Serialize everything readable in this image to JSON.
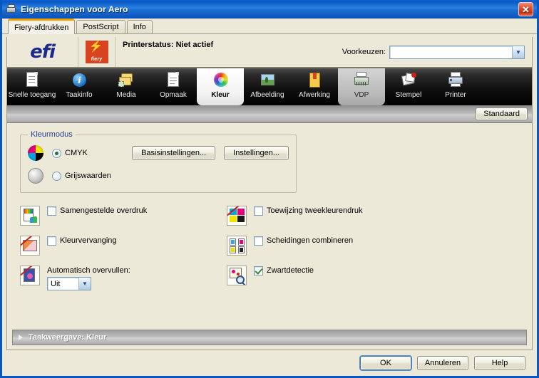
{
  "window": {
    "title": "Eigenschappen voor Aero",
    "title_icon": "printer-properties-icon",
    "close_label": "✕"
  },
  "tabs": [
    {
      "label": "Fiery-afdrukken",
      "active": true
    },
    {
      "label": "PostScript",
      "active": false
    },
    {
      "label": "Info",
      "active": false
    }
  ],
  "header": {
    "efi_logo": "efi",
    "fiery_logo": "fiery",
    "status": "Printerstatus: Niet actief",
    "preset_label": "Voorkeuzen:",
    "preset_value": "",
    "preset_placeholder": ""
  },
  "iconbar": {
    "items": [
      {
        "label": "Snelle toegang",
        "icon": "document-quick-access-icon",
        "state": "normal"
      },
      {
        "label": "Taakinfo",
        "icon": "info-circle-icon",
        "state": "normal"
      },
      {
        "label": "Media",
        "icon": "media-stack-icon",
        "state": "normal"
      },
      {
        "label": "Opmaak",
        "icon": "layout-page-icon",
        "state": "normal"
      },
      {
        "label": "Kleur",
        "icon": "color-wheel-icon",
        "state": "selected"
      },
      {
        "label": "Afbeelding",
        "icon": "picture-icon",
        "state": "normal"
      },
      {
        "label": "Afwerking",
        "icon": "book-finishing-icon",
        "state": "normal"
      },
      {
        "label": "VDP",
        "icon": "vdp-printer-icon",
        "state": "hover"
      },
      {
        "label": "Stempel",
        "icon": "stamp-icon",
        "state": "normal"
      },
      {
        "label": "Printer",
        "icon": "printer-icon",
        "state": "normal"
      }
    ]
  },
  "toolbar": {
    "standaard_label": "Standaard"
  },
  "colormode": {
    "group_title": "Kleurmodus",
    "options": [
      {
        "label": "CMYK",
        "checked": true,
        "swatch": "cmyk-wheel-icon"
      },
      {
        "label": "Grijswaarden",
        "checked": false,
        "swatch": "grayscale-sphere-icon"
      }
    ],
    "buttons": [
      {
        "label": "Basisinstellingen..."
      },
      {
        "label": "Instellingen..."
      }
    ]
  },
  "options_left": [
    {
      "label": "Samengestelde overdruk",
      "checked": false,
      "icon": "composite-overprint-icon",
      "type": "checkbox"
    },
    {
      "label": "Kleurvervanging",
      "checked": false,
      "icon": "spot-color-replace-icon",
      "type": "checkbox"
    },
    {
      "label": "Automatisch overvullen:",
      "type": "combo",
      "value": "Uit",
      "icon": "auto-trapping-icon"
    }
  ],
  "options_right": [
    {
      "label": "Toewijzing tweekleurendruk",
      "checked": false,
      "icon": "two-color-print-mapping-icon",
      "type": "checkbox"
    },
    {
      "label": "Scheidingen combineren",
      "checked": false,
      "icon": "combine-separations-icon",
      "type": "checkbox"
    },
    {
      "label": "Zwartdetectie",
      "checked": true,
      "icon": "black-detection-icon",
      "type": "checkbox"
    }
  ],
  "collapse": {
    "label": "Taakweergave: Kleur",
    "expanded": false
  },
  "footer": {
    "ok": "OK",
    "cancel": "Annuleren",
    "help": "Help"
  },
  "colors": {
    "titlebar": "#0a57c2",
    "accent_tab": "#f0a000",
    "background": "#ece9d8",
    "fiery_red": "#d8441f",
    "efi_blue": "#1b2a8c",
    "check_green": "#2f8b2f"
  }
}
